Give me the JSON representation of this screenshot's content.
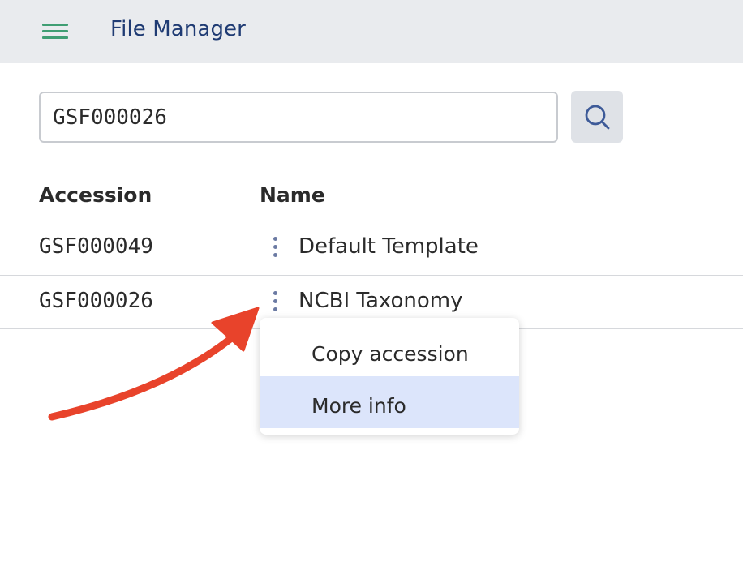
{
  "header": {
    "title": "File Manager",
    "menu_icon": "hamburger-menu-icon",
    "menu_color": "#3f9e73",
    "background": "#e9ebee"
  },
  "search": {
    "value": "GSF000026",
    "button_icon": "search-icon"
  },
  "table": {
    "columns": [
      "Accession",
      "Name"
    ],
    "rows": [
      {
        "accession": "GSF000049",
        "name": "Default Template"
      },
      {
        "accession": "GSF000026",
        "name": "NCBI Taxonomy"
      }
    ]
  },
  "context_menu": {
    "items": [
      {
        "label": "Copy accession",
        "highlighted": false
      },
      {
        "label": "More info",
        "highlighted": true
      }
    ],
    "highlight_color": "#dce5fb"
  },
  "annotation": {
    "icon": "red-arrow-annotation",
    "color": "#e8432b"
  }
}
